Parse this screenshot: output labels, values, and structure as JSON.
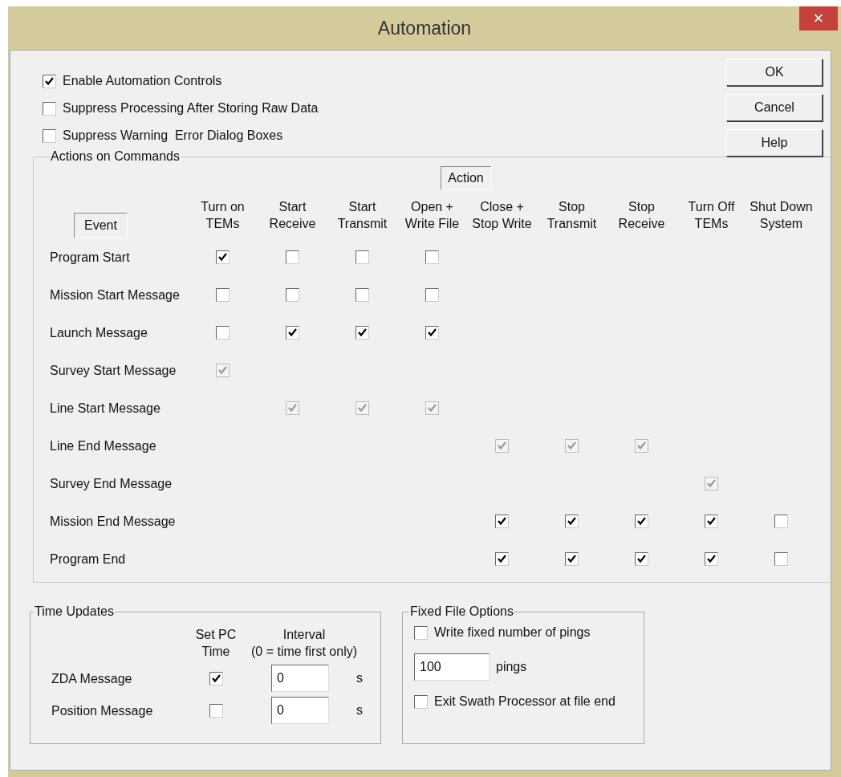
{
  "window": {
    "title": "Automation",
    "close": "×"
  },
  "top_options": [
    {
      "label": "Enable Automation Controls",
      "checked": true
    },
    {
      "label": "Suppress Processing After Storing Raw Data",
      "checked": false
    },
    {
      "label": "Suppress Warning  Error Dialog Boxes",
      "checked": false
    }
  ],
  "buttons": [
    "OK",
    "Cancel",
    "Help"
  ],
  "actions": {
    "title": "Actions on Commands",
    "action_header": "Action",
    "event_header": "Event",
    "columns": [
      "Turn on\nTEMs",
      "Start\nReceive",
      "Start\nTransmit",
      "Open +\nWrite File",
      "Close +\nStop Write",
      "Stop\nTransmit",
      "Stop\nReceive",
      "Turn Off\nTEMs",
      "Shut Down\nSystem"
    ],
    "events": [
      {
        "label": "Program Start",
        "cells": [
          {
            "kind": "checkbox",
            "checked": true,
            "disabled": false
          },
          {
            "kind": "checkbox",
            "checked": false,
            "disabled": false
          },
          {
            "kind": "checkbox",
            "checked": false,
            "disabled": false
          },
          {
            "kind": "checkbox",
            "checked": false,
            "disabled": false
          },
          {
            "kind": "none"
          },
          {
            "kind": "none"
          },
          {
            "kind": "none"
          },
          {
            "kind": "none"
          },
          {
            "kind": "none"
          }
        ]
      },
      {
        "label": "Mission Start Message",
        "cells": [
          {
            "kind": "checkbox",
            "checked": false,
            "disabled": false
          },
          {
            "kind": "checkbox",
            "checked": false,
            "disabled": false
          },
          {
            "kind": "checkbox",
            "checked": false,
            "disabled": false
          },
          {
            "kind": "checkbox",
            "checked": false,
            "disabled": false
          },
          {
            "kind": "none"
          },
          {
            "kind": "none"
          },
          {
            "kind": "none"
          },
          {
            "kind": "none"
          },
          {
            "kind": "none"
          }
        ]
      },
      {
        "label": "Launch Message",
        "cells": [
          {
            "kind": "checkbox",
            "checked": false,
            "disabled": false
          },
          {
            "kind": "checkbox",
            "checked": true,
            "disabled": false
          },
          {
            "kind": "checkbox",
            "checked": true,
            "disabled": false
          },
          {
            "kind": "checkbox",
            "checked": true,
            "disabled": false
          },
          {
            "kind": "none"
          },
          {
            "kind": "none"
          },
          {
            "kind": "none"
          },
          {
            "kind": "none"
          },
          {
            "kind": "none"
          }
        ]
      },
      {
        "label": "Survey Start Message",
        "cells": [
          {
            "kind": "checkbox",
            "checked": true,
            "disabled": true
          },
          {
            "kind": "none"
          },
          {
            "kind": "none"
          },
          {
            "kind": "none"
          },
          {
            "kind": "none"
          },
          {
            "kind": "none"
          },
          {
            "kind": "none"
          },
          {
            "kind": "none"
          },
          {
            "kind": "none"
          }
        ]
      },
      {
        "label": "Line Start Message",
        "cells": [
          {
            "kind": "none"
          },
          {
            "kind": "checkbox",
            "checked": true,
            "disabled": true
          },
          {
            "kind": "checkbox",
            "checked": true,
            "disabled": true
          },
          {
            "kind": "checkbox",
            "checked": true,
            "disabled": true
          },
          {
            "kind": "none"
          },
          {
            "kind": "none"
          },
          {
            "kind": "none"
          },
          {
            "kind": "none"
          },
          {
            "kind": "none"
          }
        ]
      },
      {
        "label": "Line End Message",
        "cells": [
          {
            "kind": "none"
          },
          {
            "kind": "none"
          },
          {
            "kind": "none"
          },
          {
            "kind": "none"
          },
          {
            "kind": "checkbox",
            "checked": true,
            "disabled": true
          },
          {
            "kind": "checkbox",
            "checked": true,
            "disabled": true
          },
          {
            "kind": "checkbox",
            "checked": true,
            "disabled": true
          },
          {
            "kind": "none"
          },
          {
            "kind": "none"
          }
        ]
      },
      {
        "label": "Survey End Message",
        "cells": [
          {
            "kind": "none"
          },
          {
            "kind": "none"
          },
          {
            "kind": "none"
          },
          {
            "kind": "none"
          },
          {
            "kind": "none"
          },
          {
            "kind": "none"
          },
          {
            "kind": "none"
          },
          {
            "kind": "checkbox",
            "checked": true,
            "disabled": true
          },
          {
            "kind": "none"
          }
        ]
      },
      {
        "label": "Mission End Message",
        "cells": [
          {
            "kind": "none"
          },
          {
            "kind": "none"
          },
          {
            "kind": "none"
          },
          {
            "kind": "none"
          },
          {
            "kind": "checkbox",
            "checked": true,
            "disabled": false
          },
          {
            "kind": "checkbox",
            "checked": true,
            "disabled": false
          },
          {
            "kind": "checkbox",
            "checked": true,
            "disabled": false
          },
          {
            "kind": "checkbox",
            "checked": true,
            "disabled": false
          },
          {
            "kind": "checkbox",
            "checked": false,
            "disabled": false
          }
        ]
      },
      {
        "label": "Program End",
        "cells": [
          {
            "kind": "none"
          },
          {
            "kind": "none"
          },
          {
            "kind": "none"
          },
          {
            "kind": "none"
          },
          {
            "kind": "checkbox",
            "checked": true,
            "disabled": false
          },
          {
            "kind": "checkbox",
            "checked": true,
            "disabled": false
          },
          {
            "kind": "checkbox",
            "checked": true,
            "disabled": false
          },
          {
            "kind": "checkbox",
            "checked": true,
            "disabled": false
          },
          {
            "kind": "checkbox",
            "checked": false,
            "disabled": false
          }
        ]
      }
    ]
  },
  "time_updates": {
    "title": "Time Updates",
    "set_pc_header": "Set PC\nTime",
    "interval_header": "Interval\n(0 = time first only)",
    "rows": [
      {
        "label": "ZDA Message",
        "set_pc_time": true,
        "interval": "0",
        "unit": "s"
      },
      {
        "label": "Position Message",
        "set_pc_time": false,
        "interval": "0",
        "unit": "s"
      }
    ]
  },
  "fixed_file": {
    "title": "Fixed File Options",
    "write_fixed": {
      "label": "Write fixed number of pings",
      "checked": false
    },
    "pings": {
      "value": "100",
      "unit": "pings"
    },
    "exit_at_end": {
      "label": "Exit Swath Processor at file end",
      "checked": false
    }
  }
}
